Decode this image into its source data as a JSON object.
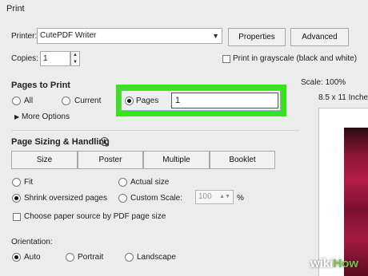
{
  "window": {
    "title": "Print"
  },
  "printer": {
    "label": "Printer:",
    "value": "CutePDF Writer",
    "properties_label": "Properties",
    "advanced_label": "Advanced"
  },
  "copies": {
    "label": "Copies:",
    "value": "1"
  },
  "grayscale": {
    "label": "Print in grayscale (black and white)",
    "checked": false
  },
  "pages_to_print": {
    "heading": "Pages to Print",
    "all_label": "All",
    "current_label": "Current",
    "pages_label": "Pages",
    "pages_value": "1",
    "more_options_label": "More Options",
    "selected": "pages"
  },
  "sizing": {
    "heading": "Page Sizing & Handling",
    "info_icon": "info-icon",
    "tabs": [
      "Size",
      "Poster",
      "Multiple",
      "Booklet"
    ],
    "fit_label": "Fit",
    "actual_size_label": "Actual size",
    "shrink_label": "Shrink oversized pages",
    "custom_scale_label": "Custom Scale:",
    "custom_scale_value": "100",
    "percent_label": "%",
    "selected": "shrink",
    "paper_source_label": "Choose paper source by PDF page size"
  },
  "orientation": {
    "heading": "Orientation:",
    "auto_label": "Auto",
    "portrait_label": "Portrait",
    "landscape_label": "Landscape",
    "selected": "auto"
  },
  "preview": {
    "scale_label": "Scale: 100%",
    "paper_label": "8.5 x 11 Inches"
  },
  "watermark": {
    "wiki": "wiki",
    "how": "How"
  },
  "colors": {
    "highlight": "#34e51a"
  }
}
